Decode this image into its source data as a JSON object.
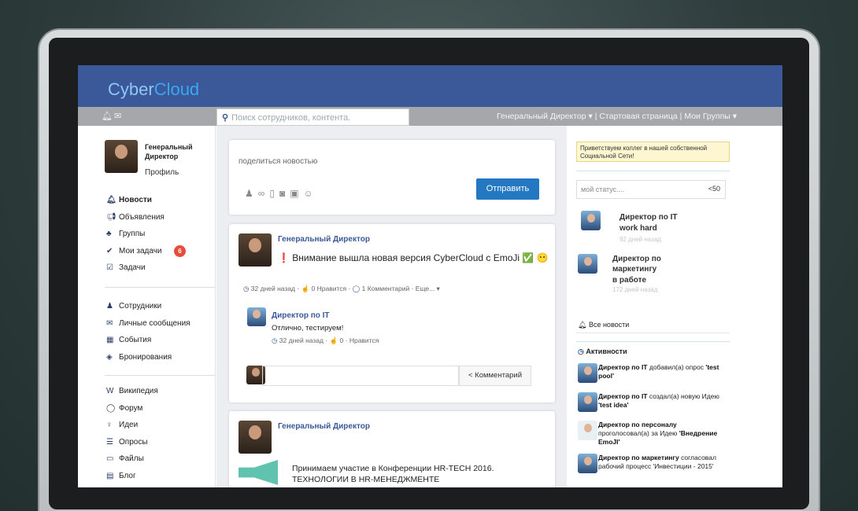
{
  "header": {
    "logo_part1": "Cyber",
    "logo_part2": "Cloud"
  },
  "topbar": {
    "search_placeholder": "Поиск сотрудников, контента.",
    "nav": "Генеральный Директор ▾ | Стартовая страница | Мои Группы ▾"
  },
  "profile": {
    "name": "Генеральный Директор",
    "link": "Профиль"
  },
  "menu": {
    "group1": [
      {
        "icon": "bell-icon",
        "label": "Новости",
        "active": true
      },
      {
        "icon": "megaphone-icon",
        "label": "Объявления"
      },
      {
        "icon": "sitemap-icon",
        "label": "Группы"
      },
      {
        "icon": "check-icon",
        "label": "Мои задачи",
        "badge": "6"
      },
      {
        "icon": "checkbox-icon",
        "label": "Задачи"
      }
    ],
    "group2": [
      {
        "icon": "user-icon",
        "label": "Сотрудники"
      },
      {
        "icon": "envelope-icon",
        "label": "Личные сообщения"
      },
      {
        "icon": "calendar-icon",
        "label": "События"
      },
      {
        "icon": "tag-icon",
        "label": "Бронирования"
      }
    ],
    "group3": [
      {
        "icon": "wikipedia-icon",
        "label": "Википедия"
      },
      {
        "icon": "chat-icon",
        "label": "Форум"
      },
      {
        "icon": "bulb-icon",
        "label": "Идеи"
      },
      {
        "icon": "list-icon",
        "label": "Опросы"
      },
      {
        "icon": "folder-icon",
        "label": "Файлы"
      },
      {
        "icon": "file-icon",
        "label": "Блог"
      }
    ]
  },
  "share": {
    "placeholder": "поделиться новостью",
    "send": "Отправить"
  },
  "post1": {
    "author": "Генеральный Директор",
    "text": "❗ Внимание вышла новая версия CyberCloud  с EmoJi ✅ 😶",
    "time": "32 дней назад",
    "likes": "0 Нравится",
    "comments": "1 Комментарий",
    "more": "Еще... ▾",
    "comment": {
      "author": "Директор по IT",
      "text": "Отлично, тестируем!",
      "time": "32 дней назад",
      "likes": "0 · Нравится"
    },
    "comment_button": "Комментарий"
  },
  "post2": {
    "author": "Генеральный Директор",
    "text_line1": "Принимаем участие в Конференции HR-TECH 2016.",
    "text_line2": "ТЕХНОЛОГИИ В HR-МЕНЕДЖМЕНТЕ"
  },
  "right": {
    "notice": "Приветствуем коллег в нашей собственной Социальной Сети!",
    "status_placeholder": "мой статус....",
    "status_count": "50",
    "statuses": [
      {
        "name": "Директор по IT",
        "status": "work hard",
        "time": "92 дней назад"
      },
      {
        "name_line1": "Директор по",
        "name_line2": "маркетингу",
        "status": "в работе",
        "time": "172 дней назад"
      }
    ],
    "all_news": "Все новости",
    "activity_title": "Активности",
    "activities": [
      {
        "who": "Директор по IT",
        "what": " добавил(а) опрос ",
        "obj": "'test pool'"
      },
      {
        "who": "Директор по IT",
        "what": " создал(а) новую Идею ",
        "obj": "'test idea'"
      },
      {
        "who": "Директор по персоналу",
        "what": " проголосовал(а) за Идею ",
        "obj": "'Внедрение EmoJI'"
      },
      {
        "who": "Директор по маркетингу",
        "what": " согласовал рабочий процесс ",
        "obj": "'Инвестиции - 2015'"
      }
    ]
  }
}
